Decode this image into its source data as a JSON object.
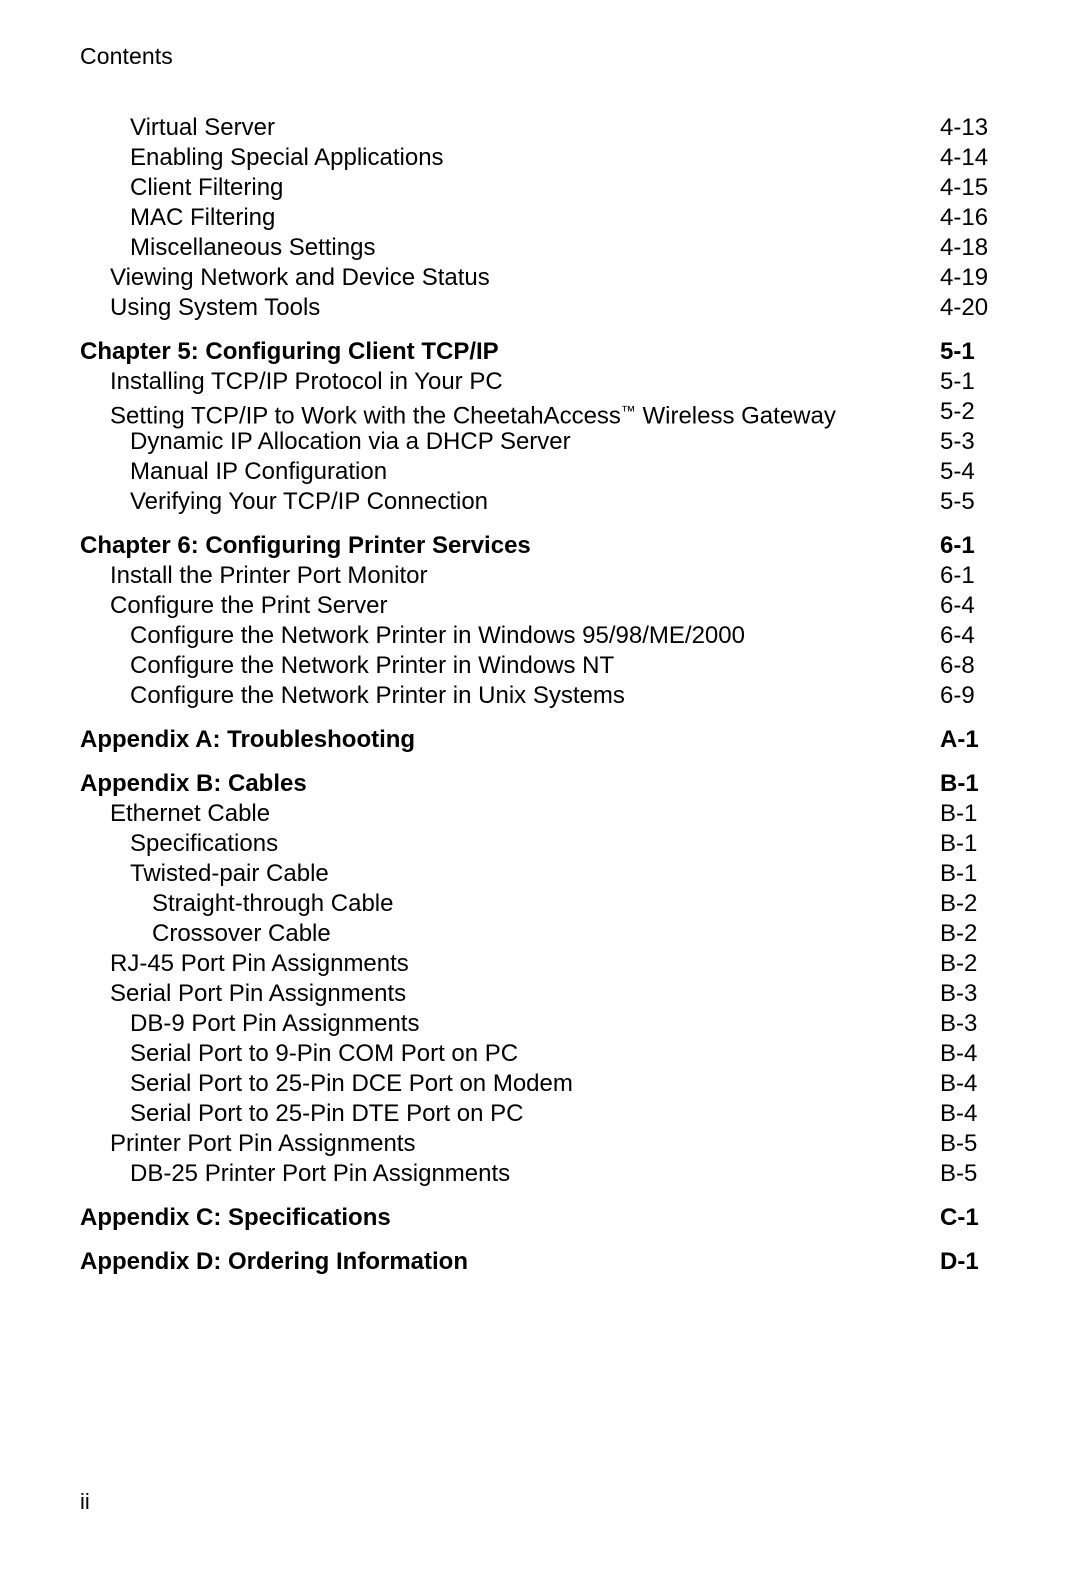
{
  "document": {
    "running_head": "Contents",
    "folio": "ii"
  },
  "toc": {
    "entries": [
      {
        "title": "Virtual Server",
        "page": "4-13",
        "level": 2,
        "heading": false
      },
      {
        "title": "Enabling Special Applications",
        "page": "4-14",
        "level": 2,
        "heading": false
      },
      {
        "title": "Client Filtering",
        "page": "4-15",
        "level": 2,
        "heading": false
      },
      {
        "title": "MAC Filtering",
        "page": "4-16",
        "level": 2,
        "heading": false
      },
      {
        "title": "Miscellaneous Settings",
        "page": "4-18",
        "level": 2,
        "heading": false
      },
      {
        "title": "Viewing Network and Device Status",
        "page": "4-19",
        "level": 1,
        "heading": false
      },
      {
        "title": "Using System Tools",
        "page": "4-20",
        "level": 1,
        "heading": false
      },
      {
        "title": "Chapter 5: Configuring Client TCP/IP",
        "page": "5-1",
        "level": 0,
        "heading": true
      },
      {
        "title": "Installing TCP/IP Protocol in Your PC",
        "page": "5-1",
        "level": 1,
        "heading": false
      },
      {
        "title_html": "Setting TCP/IP to Work with the CheetahAccess<span class=\"tm\">™</span> Wireless Gateway",
        "title": "Setting TCP/IP to Work with the CheetahAccess™ Wireless Gateway",
        "page": "5-2",
        "level": 1,
        "heading": false
      },
      {
        "title": "Dynamic IP Allocation via a DHCP Server",
        "page": "5-3",
        "level": 2,
        "heading": false
      },
      {
        "title": "Manual IP Configuration",
        "page": "5-4",
        "level": 2,
        "heading": false
      },
      {
        "title": "Verifying Your TCP/IP Connection",
        "page": "5-5",
        "level": 2,
        "heading": false
      },
      {
        "title": "Chapter 6: Configuring Printer Services",
        "page": "6-1",
        "level": 0,
        "heading": true
      },
      {
        "title": "Install the Printer Port Monitor",
        "page": "6-1",
        "level": 1,
        "heading": false
      },
      {
        "title": "Configure the Print Server",
        "page": "6-4",
        "level": 1,
        "heading": false
      },
      {
        "title": "Configure the Network Printer in Windows 95/98/ME/2000",
        "page": "6-4",
        "level": 2,
        "heading": false
      },
      {
        "title": "Configure the Network Printer in Windows NT",
        "page": "6-8",
        "level": 2,
        "heading": false
      },
      {
        "title": "Configure the Network Printer in Unix Systems",
        "page": "6-9",
        "level": 2,
        "heading": false
      },
      {
        "title": "Appendix A: Troubleshooting",
        "page": "A-1",
        "level": 0,
        "heading": true
      },
      {
        "title": "Appendix B: Cables",
        "page": "B-1",
        "level": 0,
        "heading": true
      },
      {
        "title": "Ethernet Cable",
        "page": "B-1",
        "level": 1,
        "heading": false
      },
      {
        "title": "Specifications",
        "page": "B-1",
        "level": 2,
        "heading": false
      },
      {
        "title": "Twisted-pair Cable",
        "page": "B-1",
        "level": 2,
        "heading": false
      },
      {
        "title": "Straight-through Cable",
        "page": "B-2",
        "level": 3,
        "heading": false
      },
      {
        "title": "Crossover Cable",
        "page": "B-2",
        "level": 3,
        "heading": false
      },
      {
        "title": "RJ-45 Port Pin Assignments",
        "page": "B-2",
        "level": 1,
        "heading": false
      },
      {
        "title": "Serial Port Pin Assignments",
        "page": "B-3",
        "level": 1,
        "heading": false
      },
      {
        "title": "DB-9 Port Pin Assignments",
        "page": "B-3",
        "level": 2,
        "heading": false
      },
      {
        "title": "Serial Port to 9-Pin COM Port on PC",
        "page": "B-4",
        "level": 2,
        "heading": false
      },
      {
        "title": "Serial Port to 25-Pin DCE Port on Modem",
        "page": "B-4",
        "level": 2,
        "heading": false
      },
      {
        "title": "Serial Port to 25-Pin DTE Port on PC",
        "page": "B-4",
        "level": 2,
        "heading": false
      },
      {
        "title": "Printer Port Pin Assignments",
        "page": "B-5",
        "level": 1,
        "heading": false
      },
      {
        "title": "DB-25 Printer Port Pin Assignments",
        "page": "B-5",
        "level": 2,
        "heading": false
      },
      {
        "title": "Appendix C: Specifications",
        "page": "C-1",
        "level": 0,
        "heading": true
      },
      {
        "title": "Appendix D: Ordering Information",
        "page": "D-1",
        "level": 0,
        "heading": true
      }
    ]
  }
}
